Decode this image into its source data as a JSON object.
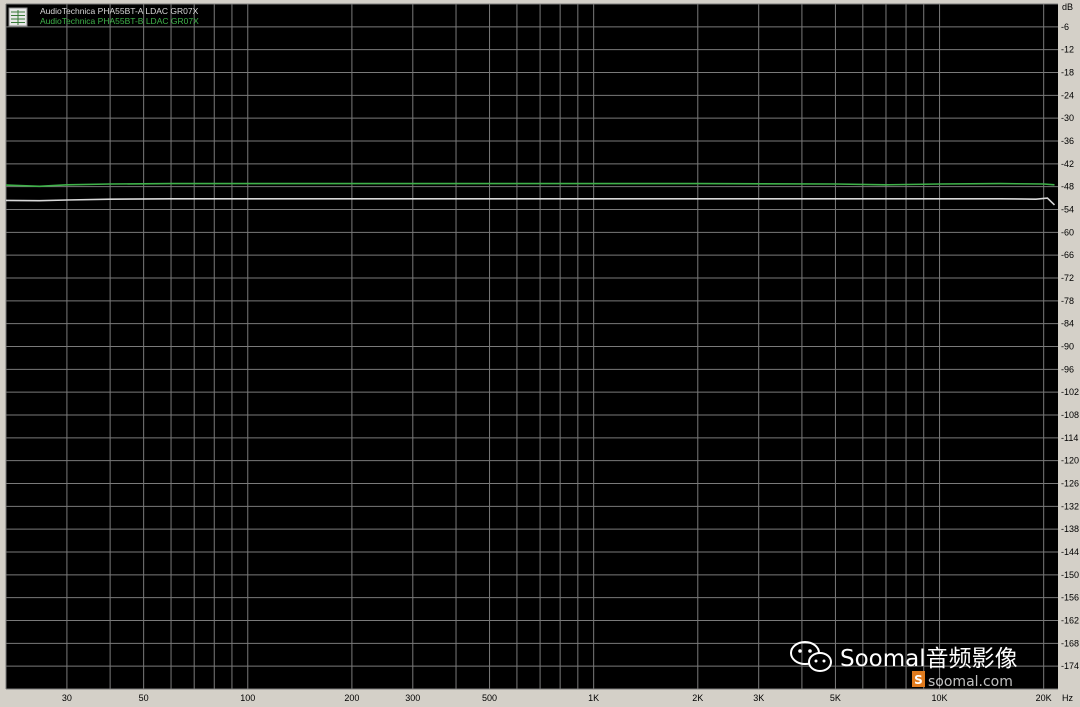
{
  "chart_data": {
    "type": "line",
    "x_scale": "log",
    "xlim": [
      20,
      22000
    ],
    "ylim": [
      -180,
      0
    ],
    "x_unit": "Hz",
    "y_unit": "dB",
    "grid": true,
    "legend_position": "top-left",
    "y_ticks": [
      -6,
      -12,
      -18,
      -24,
      -30,
      -36,
      -42,
      -48,
      -54,
      -60,
      -66,
      -72,
      -78,
      -84,
      -90,
      -96,
      -102,
      -108,
      -114,
      -120,
      -126,
      -132,
      -138,
      -144,
      -150,
      -156,
      -162,
      -168,
      -174
    ],
    "x_ticks": [
      {
        "value": 30,
        "label": "30"
      },
      {
        "value": 50,
        "label": "50"
      },
      {
        "value": 100,
        "label": "100"
      },
      {
        "value": 200,
        "label": "200"
      },
      {
        "value": 300,
        "label": "300"
      },
      {
        "value": 500,
        "label": "500"
      },
      {
        "value": 1000,
        "label": "1K"
      },
      {
        "value": 2000,
        "label": "2K"
      },
      {
        "value": 3000,
        "label": "3K"
      },
      {
        "value": 5000,
        "label": "5K"
      },
      {
        "value": 10000,
        "label": "10K"
      },
      {
        "value": 20000,
        "label": "20K"
      }
    ],
    "series": [
      {
        "name": "AudioTechnica PHA55BT-A LDAC GR07X",
        "color": "#d8d8d8",
        "x": [
          20,
          25,
          30,
          40,
          60,
          100,
          200,
          500,
          1000,
          2000,
          5000,
          10000,
          15000,
          19000,
          20500,
          21500
        ],
        "y": [
          -51.6,
          -51.7,
          -51.5,
          -51.3,
          -51.2,
          -51.2,
          -51.2,
          -51.2,
          -51.2,
          -51.2,
          -51.2,
          -51.2,
          -51.2,
          -51.3,
          -51.0,
          -52.8
        ]
      },
      {
        "name": "AudioTechnica PHA55BT-B LDAC GR07X",
        "color": "#3fb24a",
        "x": [
          20,
          25,
          30,
          40,
          60,
          100,
          200,
          500,
          1000,
          2000,
          5000,
          7000,
          10000,
          15000,
          20000,
          21500
        ],
        "y": [
          -47.6,
          -47.9,
          -47.5,
          -47.3,
          -47.2,
          -47.2,
          -47.2,
          -47.2,
          -47.2,
          -47.2,
          -47.3,
          -47.5,
          -47.3,
          -47.2,
          -47.3,
          -47.5
        ]
      }
    ]
  },
  "watermark": {
    "text": "Soomal音频影像",
    "site": "soomal.com",
    "logo_letter": "S",
    "icon": "wechat-icon"
  },
  "colors": {
    "plot_bg": "#000000",
    "frame_bg": "#d4d0c8",
    "grid": "#7a7a7a"
  }
}
